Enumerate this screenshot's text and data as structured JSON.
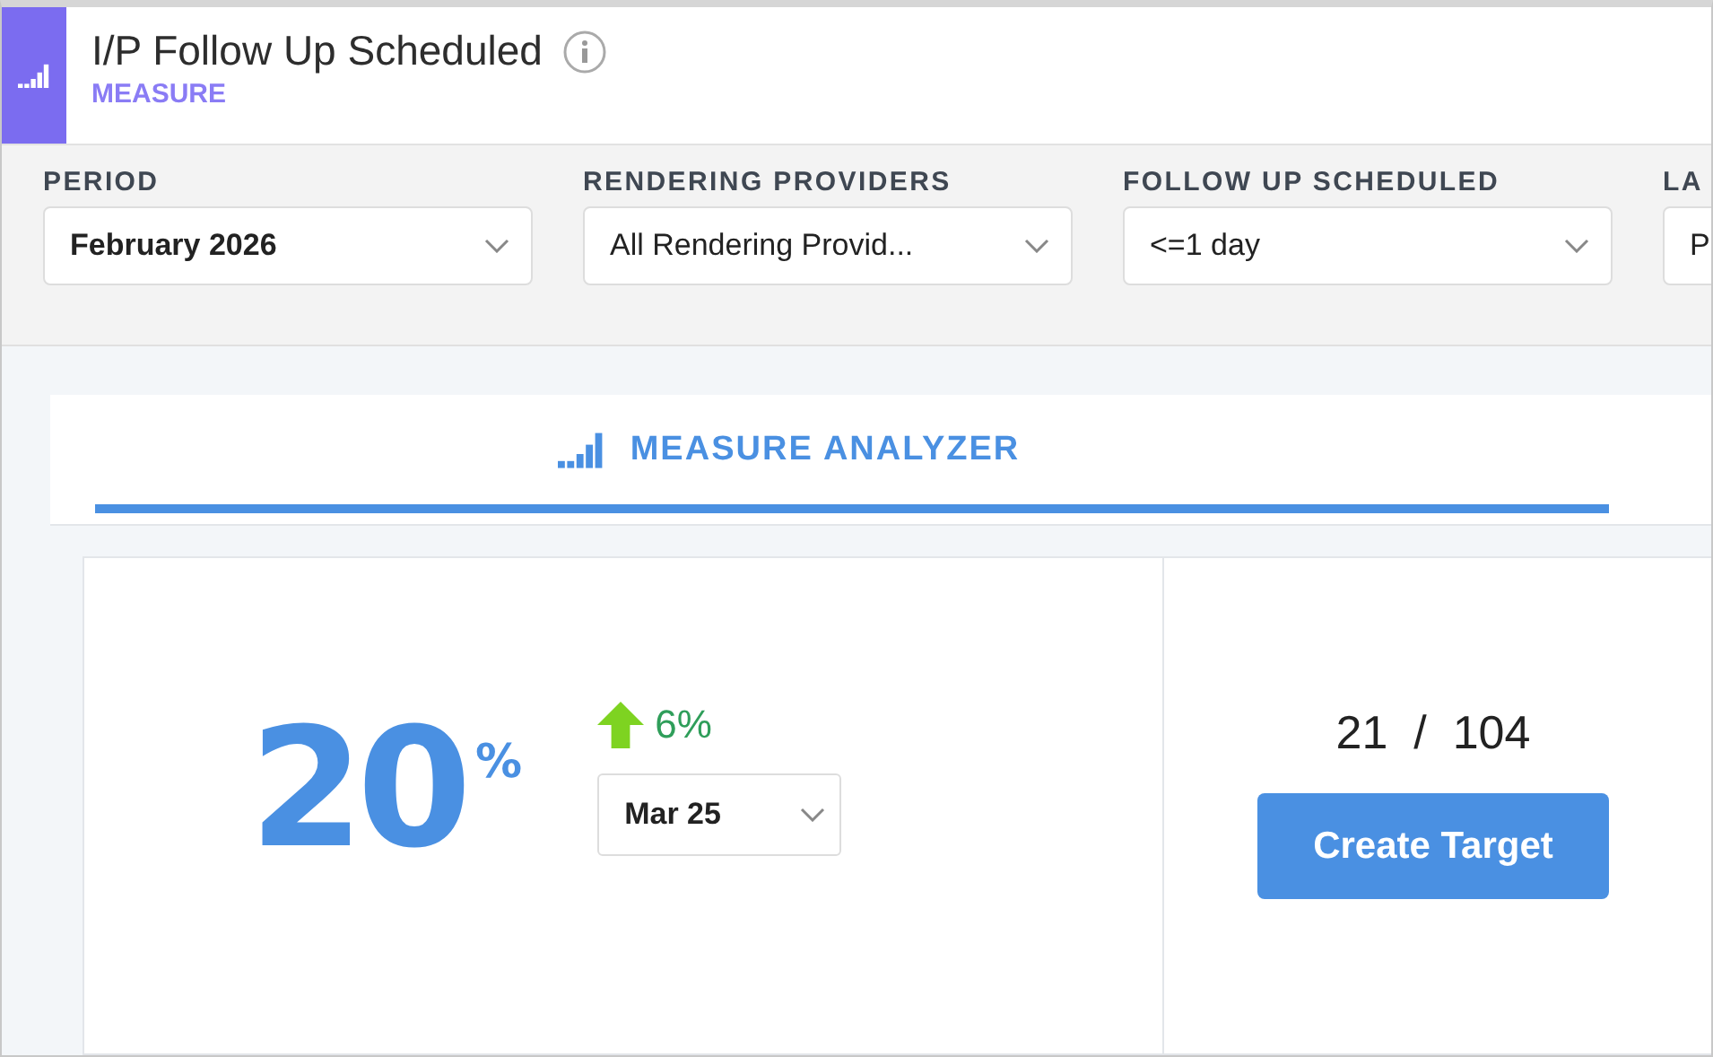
{
  "header": {
    "title": "I/P Follow Up Scheduled",
    "subtitle": "MEASURE"
  },
  "filters": [
    {
      "label": "PERIOD",
      "value": "February 2026",
      "bold": true
    },
    {
      "label": "RENDERING PROVIDERS",
      "value": "All Rendering Provid...",
      "bold": false
    },
    {
      "label": "FOLLOW UP SCHEDULED",
      "value": "<=1 day",
      "bold": false
    },
    {
      "label": "LA",
      "value": "P",
      "bold": false
    }
  ],
  "tabs": [
    {
      "label": "MEASURE ANALYZER",
      "selected": true
    }
  ],
  "score": {
    "value": "20",
    "unit": "%",
    "change": "6%",
    "compare": "Mar 25"
  },
  "counts": {
    "text": "21  /  104",
    "button": "Create Target"
  }
}
